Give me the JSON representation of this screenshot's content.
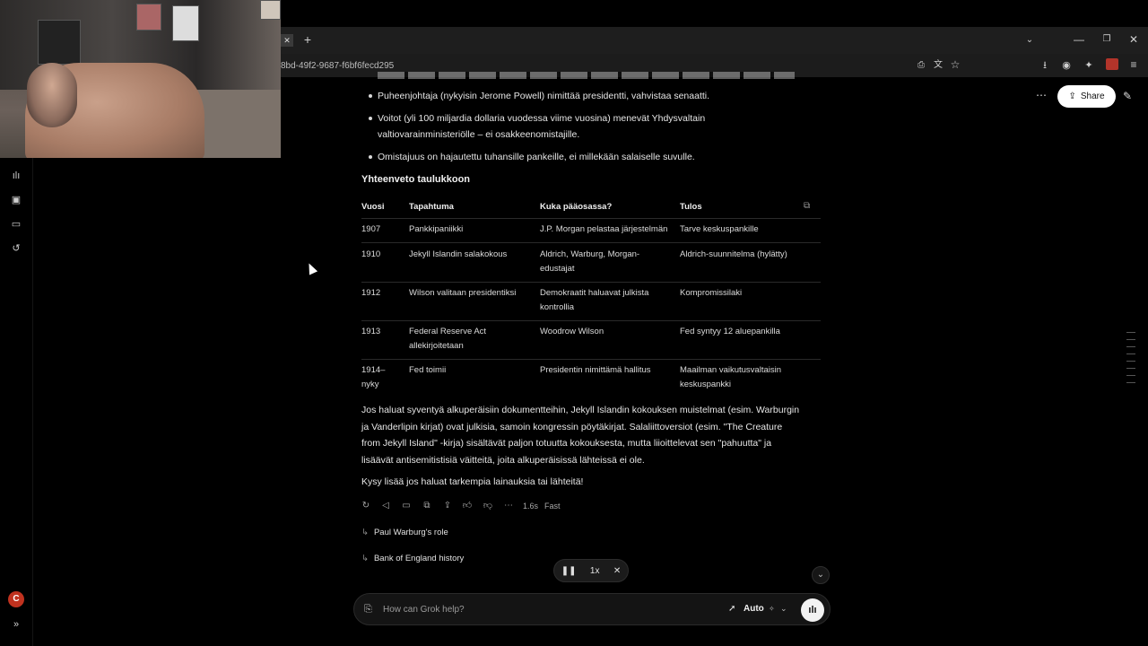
{
  "browser": {
    "url_fragment": "8bd-49f2-9687-f6bf6fecd295",
    "new_tab_icon": "+",
    "window_controls": [
      "—",
      "❐",
      "✕"
    ]
  },
  "header": {
    "share_label": "Share"
  },
  "bullets": [
    "Puheenjohtaja (nykyisin Jerome Powell) nimittää presidentti, vahvistaa senaatti.",
    "Voitot (yli 100 miljardia dollaria vuodessa viime vuosina) menevät Yhdysvaltain",
    "valtiovarainministeriölle – ei osakkeenomistajille.",
    "Omistajuus on hajautettu tuhansille pankeille, ei millekään salaiselle suvulle."
  ],
  "summary": {
    "title": "Yhteenveto taulukkoon",
    "headers": [
      "Vuosi",
      "Tapahtuma",
      "Kuka pääosassa?",
      "Tulos"
    ],
    "rows": [
      [
        "1907",
        "Pankkipaniikki",
        "",
        "J.P. Morgan pelastaa järjestelmän",
        "",
        "Tarve keskuspankille",
        ""
      ],
      [
        "1910",
        "Jekyll Islandin salakokous",
        "",
        "Aldrich, Warburg, Morgan-",
        "edustajat",
        "Aldrich-suunnitelma (hylätty)",
        ""
      ],
      [
        "1912",
        "Wilson valitaan presidentiksi",
        "",
        "Demokraatit haluavat julkista",
        "kontrollia",
        "Kompromissilaki",
        ""
      ],
      [
        "1913",
        "Federal Reserve Act",
        "allekirjoitetaan",
        "Woodrow Wilson",
        "",
        "Fed syntyy 12 aluepankilla",
        ""
      ],
      [
        "1914–",
        "Fed toimii",
        "",
        "Presidentin nimittämä hallitus",
        "",
        "Maailman vaikutusvaltaisin",
        "keskuspankki"
      ]
    ],
    "row_year_second": [
      "",
      "",
      "",
      "",
      "nyky"
    ]
  },
  "paragraph": [
    "Jos haluat syventyä alkuperäisiin dokumentteihin, Jekyll Islandin kokouksen muistelmat (esim. Warburgin",
    "ja Vanderlipin kirjat) ovat julkisia, samoin kongressin pöytäkirjat. Salaliittoversiot (esim. \"The Creature",
    "from Jekyll Island\" -kirja) sisältävät paljon totuutta kokouksesta, mutta liioittelevat sen \"pahuutta\" ja",
    "lisäävät antisemitistisiä väitteitä, joita alkuperäisissä lähteissä ei ole."
  ],
  "closing": "Kysy lisää jos haluat tarkempia lainauksia tai lähteitä!",
  "actions": {
    "time": "1.6s",
    "mode": "Fast",
    "icons": [
      "regenerate-icon",
      "speaker-icon",
      "comment-icon",
      "copy-icon",
      "share-icon",
      "thumbs-up-icon",
      "thumbs-down-icon",
      "more-icon"
    ]
  },
  "followups": [
    "Paul Warburg's role",
    "Bank of England history"
  ],
  "player": {
    "speed": "1x"
  },
  "composer": {
    "placeholder": "How can Grok help?",
    "model": "Auto"
  },
  "user": {
    "initial": "C"
  }
}
